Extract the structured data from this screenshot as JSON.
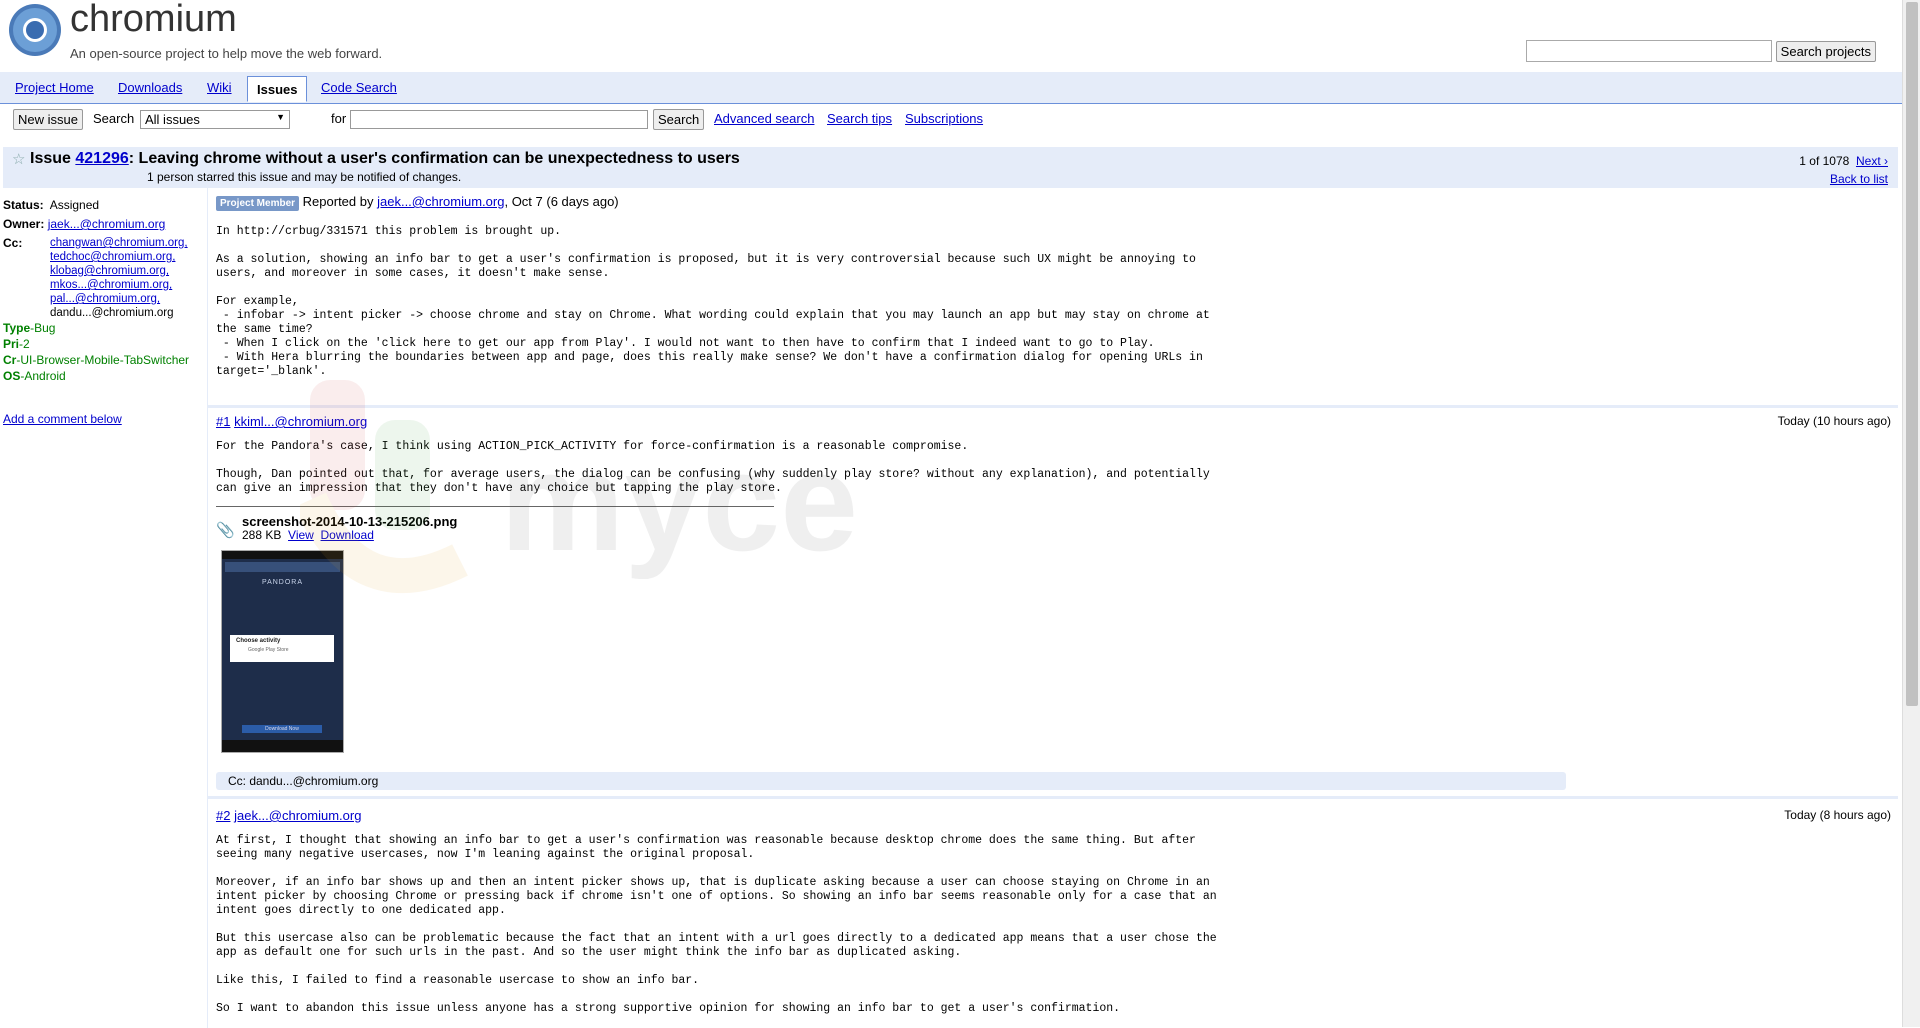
{
  "site": {
    "name": "chromium",
    "tagline": "An open-source project to help move the web forward."
  },
  "project_search": {
    "button": "Search projects",
    "value": ""
  },
  "tabs": [
    {
      "label": "Project Home"
    },
    {
      "label": "Downloads"
    },
    {
      "label": "Wiki"
    },
    {
      "label": "Issues"
    },
    {
      "label": "Code Search"
    }
  ],
  "searchbar": {
    "new_issue": "New issue",
    "search_label": "Search",
    "scope": "All issues",
    "for_label": "for",
    "query": "",
    "search_button": "Search",
    "advanced": "Advanced search",
    "tips": "Search tips",
    "subscriptions": "Subscriptions"
  },
  "issue": {
    "prefix": "Issue",
    "id": "421296",
    "title": ": Leaving chrome without a user's confirmation can be unexpectedness to users",
    "starred": "1 person starred this issue and may be notified of changes.",
    "pager": {
      "position": "1 of 1078",
      "next": "Next ›",
      "back": "Back to list"
    }
  },
  "meta": {
    "status_label": "Status:",
    "status": "Assigned",
    "owner_label": "Owner:",
    "owner": "jaek...@chromium.org",
    "cc_label": "Cc:",
    "cc": [
      "changwan@chromium.org,",
      "tedchoc@chromium.org,",
      "klobag@chromium.org,",
      "mkos...@chromium.org,",
      "pal...@chromium.org,",
      "dandu...@chromium.org"
    ],
    "labels": [
      {
        "key": "Type",
        "value": "-Bug"
      },
      {
        "key": "Pri",
        "value": "-2"
      },
      {
        "key": "Cr",
        "value": "-UI-Browser-Mobile-TabSwitcher"
      },
      {
        "key": "OS",
        "value": "-Android"
      }
    ],
    "add_comment": "Add a comment below"
  },
  "description": {
    "badge": "Project Member",
    "reported_by": "Reported by",
    "author": "jaek...@chromium.org",
    "date": ", Oct 7 (6 days ago)",
    "body": "In http://crbug/331571 this problem is brought up.\n\nAs a solution, showing an info bar to get a user's confirmation is proposed, but it is very controversial because such UX might be annoying to\nusers, and moreover in some cases, it doesn't make sense.\n\nFor example,\n - infobar -> intent picker -> choose chrome and stay on Chrome. What wording could explain that you may launch an app but may stay on chrome at\nthe same time?\n - When I click on the 'click here to get our app from Play'. I would not want to then have to confirm that I indeed want to go to Play.\n - With Hera blurring the boundaries between app and page, does this really make sense? We don't have a confirmation dialog for opening URLs in\ntarget='_blank'."
  },
  "comments": [
    {
      "num": "#1",
      "author": "kkiml...@chromium.org",
      "time": "Today (10 hours ago)",
      "body": "For the Pandora's case, I think using ACTION_PICK_ACTIVITY for force-confirmation is a reasonable compromise.\n\nThough, Dan pointed out that, for average users, the dialog can be confusing (why suddenly play store? without any explanation), and potentially\ncan give an impression that they don't have any choice but tapping the play store.",
      "attachment": {
        "name": "screenshot-2014-10-13-215206.png",
        "size": "288 KB",
        "view": "View",
        "download": "Download"
      },
      "thumb": {
        "app": "PANDORA",
        "dialog_title": "Choose activity",
        "dialog_item": "Google Play Store",
        "button": "Download Now"
      },
      "cc_change": "Cc: dandu...@chromium.org"
    },
    {
      "num": "#2",
      "author": "jaek...@chromium.org",
      "time": "Today (8 hours ago)",
      "body": "At first, I thought that showing an info bar to get a user's confirmation was reasonable because desktop chrome does the same thing. But after\nseeing many negative usercases, now I'm leaning against the original proposal.\n\nMoreover, if an info bar shows up and then an intent picker shows up, that is duplicate asking because a user can choose staying on Chrome in an\nintent picker by choosing Chrome or pressing back if chrome isn't one of options. So showing an info bar seems reasonable only for a case that an\nintent goes directly to one dedicated app.\n\nBut this usercase also can be problematic because the fact that an intent with a url goes directly to a dedicated app means that a user chose the\napp as default one for such urls in the past. And so the user might think the info bar as duplicated asking.\n\nLike this, I failed to find a reasonable usercase to show an info bar.\n\nSo I want to abandon this issue unless anyone has a strong supportive opinion for showing an info bar to get a user's confirmation."
    }
  ],
  "watermark": "myce"
}
